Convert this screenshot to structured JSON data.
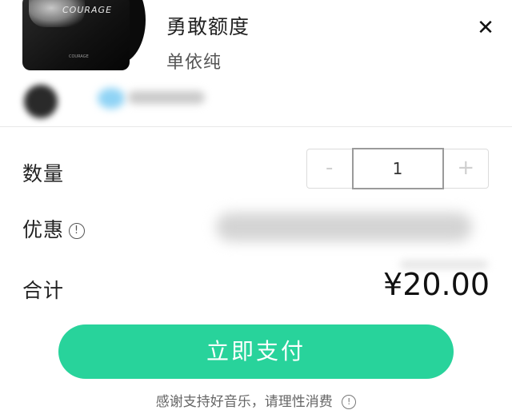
{
  "song": {
    "title": "勇敢额度",
    "artist": "单依纯",
    "cover_text": "COURAGE",
    "cover_small_text": "COURAGE"
  },
  "header": {
    "close_icon": "close-icon"
  },
  "quantity": {
    "label": "数量",
    "decrement": "-",
    "value": "1",
    "increment": "+"
  },
  "discount": {
    "label": "优惠",
    "info_icon": "info-icon",
    "info_glyph": "!"
  },
  "total": {
    "label": "合计",
    "value": "¥20.00"
  },
  "pay_button": {
    "label": "立即支付",
    "color": "#28d39b"
  },
  "footer": {
    "note": "感谢支持好音乐，请理性消费",
    "info_glyph": "!"
  }
}
